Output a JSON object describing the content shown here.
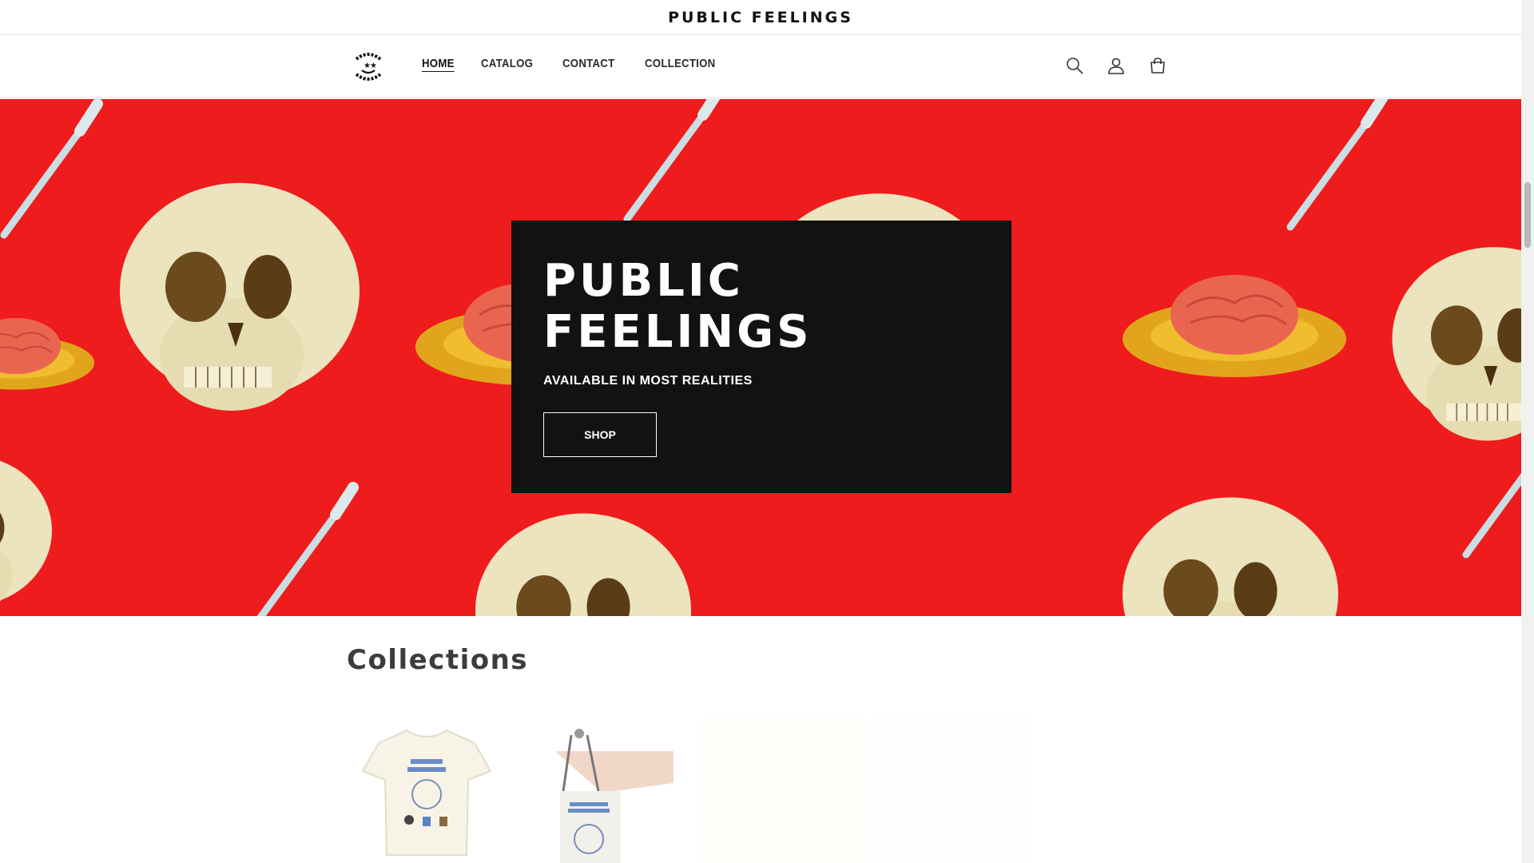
{
  "announcement": {
    "text": "PUBLIC FEELINGS"
  },
  "header": {
    "logo_alt": "PUBLIC FEELINGS",
    "nav": [
      {
        "label": "HOME",
        "active": true
      },
      {
        "label": "CATALOG",
        "active": false
      },
      {
        "label": "CONTACT",
        "active": false
      },
      {
        "label": "COLLECTION",
        "active": false
      }
    ],
    "icons": [
      "search-icon",
      "account-icon",
      "cart-icon"
    ]
  },
  "hero": {
    "title": "PUBLIC FEELINGS",
    "subtitle": "AVAILABLE IN MOST REALITIES",
    "button_label": "SHOP",
    "background_color": "#ee1c1c"
  },
  "collections": {
    "title": "Collections",
    "items": [
      {
        "image": "tshirt-product-image"
      },
      {
        "image": "tote-bag-product-image"
      }
    ]
  }
}
